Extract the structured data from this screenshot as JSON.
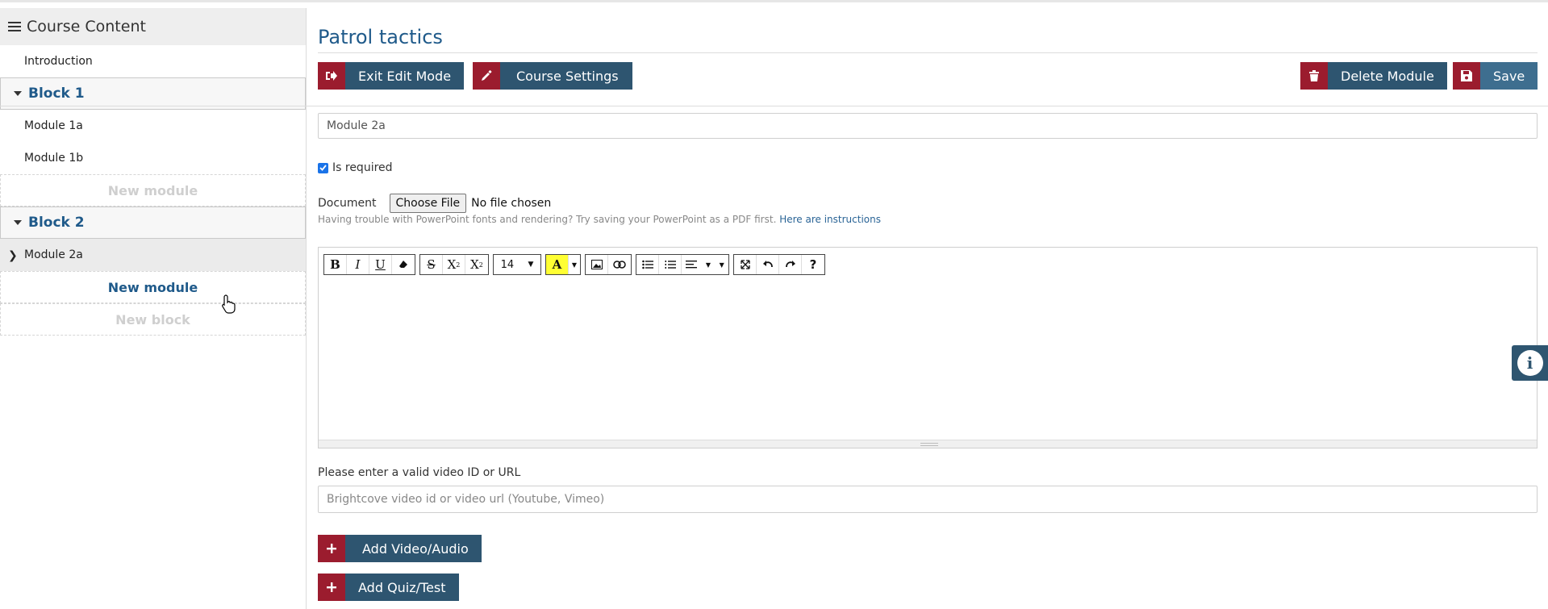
{
  "sidebar": {
    "header": "Course Content",
    "intro": "Introduction",
    "blocks": [
      {
        "label": "Block 1",
        "modules": [
          "Module 1a",
          "Module 1b"
        ],
        "new_module": "New module"
      },
      {
        "label": "Block 2",
        "modules": [
          "Module 2a"
        ],
        "new_module": "New module"
      }
    ],
    "new_block": "New block"
  },
  "main": {
    "title": "Patrol tactics",
    "buttons": {
      "exit_edit": "Exit Edit Mode",
      "course_settings": "Course Settings",
      "delete_module": "Delete Module",
      "save": "Save"
    },
    "module_name": "Module 2a",
    "is_required_label": "Is required",
    "is_required": true,
    "document_label": "Document",
    "choose_file": "Choose File",
    "no_file": "No file chosen",
    "hint": "Having trouble with PowerPoint fonts and rendering? Try saving your PowerPoint as a PDF first.",
    "hint_link": "Here are instructions",
    "editor": {
      "font_size": "14"
    },
    "video_label": "Please enter a valid video ID or URL",
    "video_placeholder": "Brightcove video id or video url (Youtube, Vimeo)",
    "add_video": "Add Video/Audio",
    "add_quiz": "Add Quiz/Test"
  },
  "colors": {
    "accent_red": "#9b1c2e",
    "accent_blue": "#2e5570",
    "title_blue": "#1f5a8a"
  }
}
